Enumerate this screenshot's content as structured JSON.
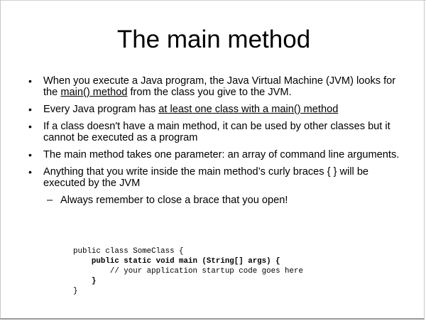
{
  "slide": {
    "title": "The main method",
    "bullets": [
      {
        "before": "When you execute a Java program, the Java Virtual Machine (JVM) looks for the ",
        "link": "main() method",
        "after": " from the class you give to the JVM."
      },
      {
        "before": "Every Java program has ",
        "link": "at least one class with a main() method",
        "after": ""
      },
      {
        "text": "If a class doesn't have a main method, it can be used by other classes but it cannot be executed as a program"
      },
      {
        "text": "The main method takes one parameter: an array of command line arguments."
      },
      {
        "text": "Anything that you write inside the main method’s curly braces { } will be executed by the JVM",
        "sub": "Always remember to close a brace that you open!"
      }
    ],
    "code_lines": [
      "public class SomeClass {",
      "    public static void main (String[] args) {",
      "        // your application startup code goes here",
      "    }",
      "}"
    ]
  }
}
